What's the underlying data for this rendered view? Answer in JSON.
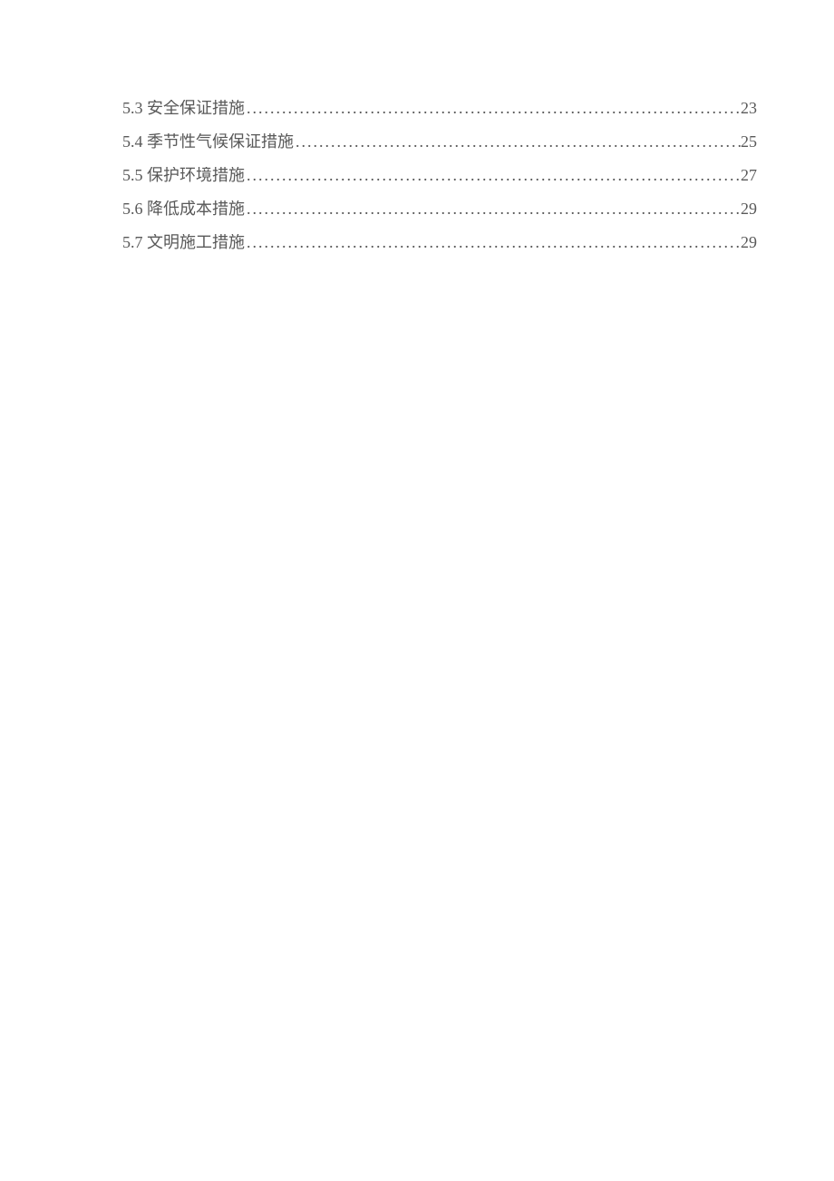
{
  "toc": {
    "entries": [
      {
        "number": "5.3",
        "title": "安全保证措施",
        "page": "23"
      },
      {
        "number": "5.4",
        "title": "季节性气候保证措施",
        "page": "25"
      },
      {
        "number": "5.5",
        "title": "保护环境措施",
        "page": "27"
      },
      {
        "number": "5.6",
        "title": "降低成本措施",
        "page": "29"
      },
      {
        "number": "5.7",
        "title": "文明施工措施",
        "page": "29"
      }
    ]
  }
}
